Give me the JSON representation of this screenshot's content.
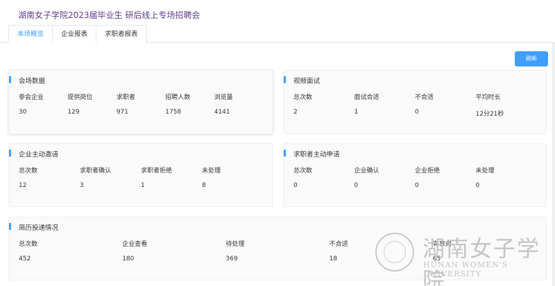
{
  "page_title": "湖南女子学院2023届毕业生 研后线上专场招聘会",
  "tabs": [
    "本场概览",
    "企业报表",
    "求职者报表"
  ],
  "refresh_label": "刷新",
  "cards": {
    "venue": {
      "title": "会场数据",
      "cols": [
        {
          "label": "参会企业",
          "value": "30"
        },
        {
          "label": "提供岗位",
          "value": "129"
        },
        {
          "label": "求职者",
          "value": "971"
        },
        {
          "label": "招聘人数",
          "value": "1758"
        },
        {
          "label": "浏览量",
          "value": "4141"
        }
      ]
    },
    "video": {
      "title": "视频面试",
      "cols": [
        {
          "label": "总次数",
          "value": "2"
        },
        {
          "label": "面试合适",
          "value": "1"
        },
        {
          "label": "不合适",
          "value": "0"
        },
        {
          "label": "平均时长",
          "value": "12分21秒"
        }
      ]
    },
    "company_invite": {
      "title": "企业主动邀请",
      "cols": [
        {
          "label": "总次数",
          "value": "12"
        },
        {
          "label": "求职者确认",
          "value": "3"
        },
        {
          "label": "求职者拒绝",
          "value": "1"
        },
        {
          "label": "未处理",
          "value": "8"
        }
      ]
    },
    "seeker_apply": {
      "title": "求职者主动申请",
      "cols": [
        {
          "label": "总次数",
          "value": "0"
        },
        {
          "label": "企业确认",
          "value": "0"
        },
        {
          "label": "企业拒绝",
          "value": "0"
        },
        {
          "label": "未处理",
          "value": "0"
        }
      ]
    },
    "resume": {
      "title": "简历投递情况",
      "cols": [
        {
          "label": "总次数",
          "value": "452"
        },
        {
          "label": "企业查看",
          "value": "180"
        },
        {
          "label": "待处理",
          "value": "369"
        },
        {
          "label": "不合适",
          "value": "18"
        },
        {
          "label": "有意向",
          "value": "65"
        }
      ]
    }
  },
  "watermark": {
    "cn": "湖南女子学院",
    "en": "HUNAN WOMEN'S UNIVERSITY"
  },
  "colors": {
    "accent": "#409eff",
    "title": "#5b3e8a"
  }
}
